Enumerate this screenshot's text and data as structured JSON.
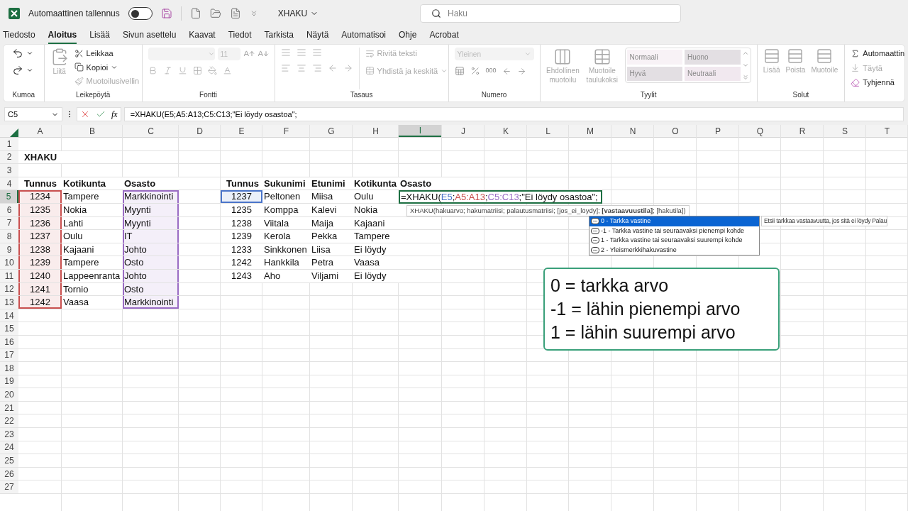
{
  "title_bar": {
    "autosave_label": "Automaattinen tallennus",
    "autosave_on": false,
    "file_name": "XHAKU",
    "search_placeholder": "Haku"
  },
  "menu_tabs": [
    {
      "label": "Tiedosto",
      "selected": false
    },
    {
      "label": "Aloitus",
      "selected": true
    },
    {
      "label": "Lisää",
      "selected": false
    },
    {
      "label": "Sivun asettelu",
      "selected": false
    },
    {
      "label": "Kaavat",
      "selected": false
    },
    {
      "label": "Tiedot",
      "selected": false
    },
    {
      "label": "Tarkista",
      "selected": false
    },
    {
      "label": "Näytä",
      "selected": false
    },
    {
      "label": "Automatisoi",
      "selected": false
    },
    {
      "label": "Ohje",
      "selected": false
    },
    {
      "label": "Acrobat",
      "selected": false
    }
  ],
  "ribbon": {
    "undo": {
      "label": "Kumoa"
    },
    "clipboard": {
      "label": "Leikepöytä",
      "paste": {
        "label": "Liitä",
        "disabled": true
      },
      "cut": {
        "label": "Leikkaa",
        "disabled": false
      },
      "copy": {
        "label": "Kopioi",
        "disabled": false
      },
      "format_painter": {
        "label": "Muotoilusivellin",
        "disabled": true
      }
    },
    "font": {
      "label": "Fontti",
      "font_size": "11"
    },
    "alignment": {
      "label": "Tasaus",
      "wrap_text": {
        "label": "Rivitä teksti",
        "disabled": true
      },
      "merge": {
        "label": "Yhdistä ja keskitä",
        "disabled": true
      }
    },
    "number": {
      "label": "Numero",
      "format": "Yleinen",
      "comma_style": "000"
    },
    "styles": {
      "label": "Tyylit",
      "conditional": {
        "label": "Ehdollinen muotoilu",
        "disabled": true
      },
      "as_table": {
        "label": "Muotoile taulukoksi",
        "disabled": true
      },
      "gallery": [
        {
          "label": "Normaali",
          "color": "#f8f2f6"
        },
        {
          "label": "Huono",
          "color": "#e3dfe3"
        },
        {
          "label": "Hyvä",
          "color": "#e3dfe3"
        },
        {
          "label": "Neutraali",
          "color": "#f1e8ef"
        }
      ]
    },
    "cells": {
      "label": "Solut",
      "buttons": [
        {
          "label": "Lisää",
          "disabled": true
        },
        {
          "label": "Poista",
          "disabled": true
        },
        {
          "label": "Muotoile",
          "disabled": true
        }
      ]
    },
    "editing": {
      "buttons": [
        {
          "kind": "autosum",
          "label": "Automaattin",
          "disabled": false
        },
        {
          "kind": "fill",
          "label": "Täytä",
          "disabled": true
        },
        {
          "kind": "clear",
          "label": "Tyhjennä",
          "disabled": false
        }
      ]
    }
  },
  "formula_bar": {
    "name_box": "C5",
    "fx_label": "fx",
    "formula": "=XHAKU(E5;A5:A13;C5:C13;\"Ei löydy osastoa\";"
  },
  "sheet": {
    "columns": [
      {
        "label": "A",
        "selected": false
      },
      {
        "label": "B",
        "selected": false
      },
      {
        "label": "C",
        "selected": false
      },
      {
        "label": "D",
        "selected": false
      },
      {
        "label": "E",
        "selected": false
      },
      {
        "label": "F",
        "selected": false
      },
      {
        "label": "G",
        "selected": false
      },
      {
        "label": "H",
        "selected": false
      },
      {
        "label": "I",
        "selected": true
      },
      {
        "label": "J",
        "selected": false
      },
      {
        "label": "K",
        "selected": false
      },
      {
        "label": "L",
        "selected": false
      },
      {
        "label": "M",
        "selected": false
      },
      {
        "label": "N",
        "selected": false
      },
      {
        "label": "O",
        "selected": false
      },
      {
        "label": "P",
        "selected": false
      },
      {
        "label": "Q",
        "selected": false
      },
      {
        "label": "R",
        "selected": false
      },
      {
        "label": "S",
        "selected": false
      },
      {
        "label": "T",
        "selected": false
      }
    ],
    "rows": [
      {
        "label": "1",
        "selected": false
      },
      {
        "label": "2",
        "selected": false
      },
      {
        "label": "3",
        "selected": false
      },
      {
        "label": "4",
        "selected": false
      },
      {
        "label": "5",
        "selected": true
      },
      {
        "label": "6",
        "selected": false
      },
      {
        "label": "7",
        "selected": false
      },
      {
        "label": "8",
        "selected": false
      },
      {
        "label": "9",
        "selected": false
      },
      {
        "label": "10",
        "selected": false
      },
      {
        "label": "11",
        "selected": false
      },
      {
        "label": "12",
        "selected": false
      },
      {
        "label": "13",
        "selected": false
      },
      {
        "label": "14",
        "selected": false
      },
      {
        "label": "15",
        "selected": false
      },
      {
        "label": "16",
        "selected": false
      },
      {
        "label": "17",
        "selected": false
      },
      {
        "label": "18",
        "selected": false
      },
      {
        "label": "19",
        "selected": false
      },
      {
        "label": "20",
        "selected": false
      },
      {
        "label": "21",
        "selected": false
      },
      {
        "label": "22",
        "selected": false
      },
      {
        "label": "23",
        "selected": false
      },
      {
        "label": "24",
        "selected": false
      },
      {
        "label": "25",
        "selected": false
      },
      {
        "label": "26",
        "selected": false
      },
      {
        "label": "27",
        "selected": false
      }
    ]
  },
  "left_table": {
    "title": "XHAKU",
    "columns": [
      {
        "label": "Tunnus",
        "color": "#c9504f"
      },
      {
        "label": "Kotikunta"
      },
      {
        "label": "Osasto",
        "color": "#9a6cc4"
      }
    ],
    "rows": [
      [
        "1234",
        "Tampere",
        "Markkinointi"
      ],
      [
        "1235",
        "Nokia",
        "Myynti"
      ],
      [
        "1236",
        "Lahti",
        "Myynti"
      ],
      [
        "1237",
        "Oulu",
        "IT"
      ],
      [
        "1238",
        "Kajaani",
        "Johto"
      ],
      [
        "1239",
        "Tampere",
        "Osto"
      ],
      [
        "1240",
        "Lappeenranta",
        "Johto"
      ],
      [
        "1241",
        "Tornio",
        "Osto"
      ],
      [
        "1242",
        "Vaasa",
        "Markkinointi"
      ]
    ]
  },
  "right_table": {
    "columns": [
      "Tunnus",
      "Sukunimi",
      "Etunimi",
      "Kotikunta",
      "Osasto"
    ],
    "key_cell": {
      "color": "#4a74c9"
    },
    "rows": [
      [
        "1237",
        "Peltonen",
        "Miisa",
        "Oulu"
      ],
      [
        "1235",
        "Komppa",
        "Kalevi",
        "Nokia"
      ],
      [
        "1238",
        "Viitala",
        "Maija",
        "Kajaani"
      ],
      [
        "1239",
        "Kerola",
        "Pekka",
        "Tampere"
      ],
      [
        "1233",
        "Sinkkonen",
        "Liisa",
        "Ei löydy"
      ],
      [
        "1242",
        "Hankkila",
        "Petra",
        "Vaasa"
      ],
      [
        "1243",
        "Aho",
        "Viljami",
        "Ei löydy"
      ]
    ],
    "editing_formula": [
      {
        "text": "=XHAKU("
      },
      {
        "text": "E5",
        "color": "#4a74c9"
      },
      {
        "text": ";"
      },
      {
        "text": "A5:A13",
        "color": "#c9504f"
      },
      {
        "text": ";"
      },
      {
        "text": "C5:C13",
        "color": "#9a6cc4"
      },
      {
        "text": ";\"Ei löydy osastoa\";"
      }
    ]
  },
  "function_tooltip": "XHAKU(hakuarvo; hakumatriisi; palautusmatriisi; [jos_ei_löydy]; **[vastaavuustila]**; [hakutila])",
  "autocomplete": [
    {
      "label": "0 - Tarkka vastine",
      "selected": true
    },
    {
      "label": "-1 - Tarkka vastine tai seuraavaksi pienempi kohde",
      "selected": false
    },
    {
      "label": "1 - Tarkka vastine tai seuraavaksi suurempi kohde",
      "selected": false
    },
    {
      "label": "2 - Yleismerkkihakuvastine",
      "selected": false
    }
  ],
  "option_description": "Etsii tarkkaa vastaavuutta, jos sitä ei löydy Palau",
  "annotation": [
    "0 = tarkka arvo",
    "-1 = lähin pienempi arvo",
    "1 = lähin suurempi arvo"
  ]
}
